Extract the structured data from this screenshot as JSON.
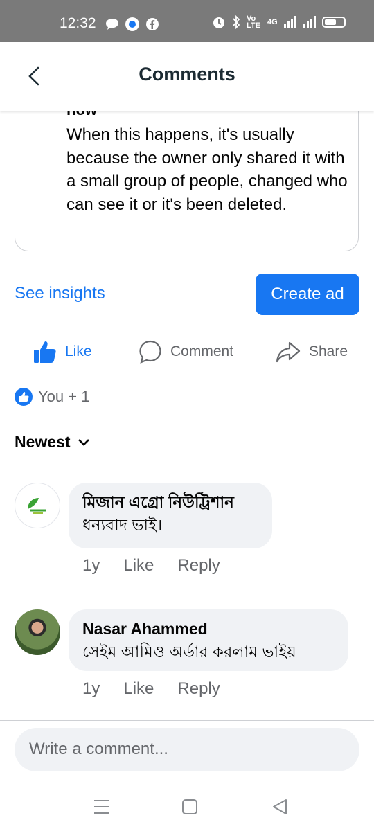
{
  "status_bar": {
    "time": "12:32",
    "network_label": "Vo LTE",
    "signal_label": "4G"
  },
  "header": {
    "title": "Comments"
  },
  "shared_post": {
    "cut_heading": "now",
    "message": "When this happens, it's usually because the owner only shared it with a small group of people, changed who can see it or it's been deleted."
  },
  "actions": {
    "see_insights": "See insights",
    "create_ad": "Create ad"
  },
  "reactions": {
    "like": "Like",
    "comment": "Comment",
    "share": "Share"
  },
  "likes_summary": "You + 1",
  "sort": {
    "label": "Newest"
  },
  "comments": [
    {
      "author": "মিজান এগ্রো নিউট্রিশান",
      "text": "ধন্যবাদ ভাই।",
      "time": "1y",
      "like": "Like",
      "reply": "Reply"
    },
    {
      "author": "Nasar Ahammed",
      "text": "সেইম আমিও অর্ডার করলাম ভাইয়",
      "time": "1y",
      "like": "Like",
      "reply": "Reply"
    }
  ],
  "composer": {
    "placeholder": "Write a comment..."
  },
  "colors": {
    "brand": "#1877f2",
    "bubble": "#f0f2f5",
    "status_bar": "#7a7a7a",
    "text_secondary": "#65676b"
  }
}
